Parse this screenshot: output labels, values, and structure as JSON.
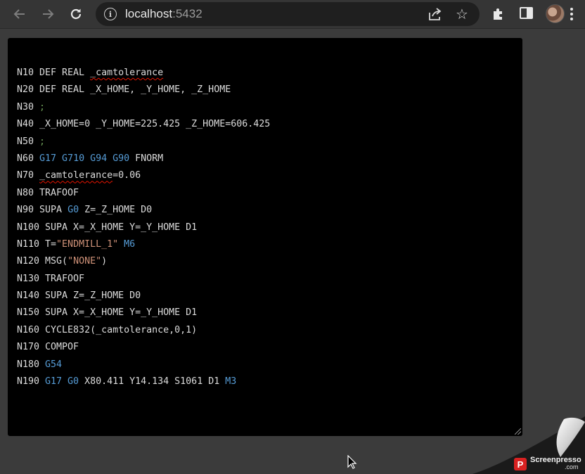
{
  "browser": {
    "url_host": "localhost",
    "url_port": ":5432",
    "icons": {
      "back": "back-arrow-icon",
      "forward": "forward-arrow-icon",
      "reload": "reload-icon",
      "info": "info-icon",
      "share": "share-icon",
      "bookmark": "star-icon",
      "extensions": "puzzle-icon",
      "side_panel": "side-panel-icon",
      "profile": "avatar",
      "menu": "kebab-menu-icon"
    }
  },
  "editor": {
    "colors": {
      "background": "#000000",
      "text": "#dcdcdc",
      "keyword": "#569cd6",
      "string": "#ce9178",
      "comment": "#6a9955",
      "squiggle": "#e51400"
    },
    "lines": [
      [
        {
          "t": "N10 DEF REAL "
        },
        {
          "t": "_camtolerance",
          "c": "sq"
        }
      ],
      [
        {
          "t": "N20 DEF REAL _X_HOME, _Y_HOME, _Z_HOME"
        }
      ],
      [
        {
          "t": "N30 "
        },
        {
          "t": ";",
          "c": "cmt"
        }
      ],
      [
        {
          "t": "N40 _X_HOME=0 _Y_HOME=225.425 _Z_HOME=606.425"
        }
      ],
      [
        {
          "t": "N50 "
        },
        {
          "t": ";",
          "c": "cmt"
        }
      ],
      [
        {
          "t": "N60 "
        },
        {
          "t": "G17 G710 G94 G90",
          "c": "kw"
        },
        {
          "t": " FNORM"
        }
      ],
      [
        {
          "t": "N70 "
        },
        {
          "t": "_camtolerance",
          "c": "sq"
        },
        {
          "t": "=0.06"
        }
      ],
      [
        {
          "t": "N80 TRAFOOF"
        }
      ],
      [
        {
          "t": "N90 SUPA "
        },
        {
          "t": "G0",
          "c": "kw"
        },
        {
          "t": " Z=_Z_HOME D0"
        }
      ],
      [
        {
          "t": "N100 SUPA X=_X_HOME Y=_Y_HOME D1"
        }
      ],
      [
        {
          "t": "N110 T="
        },
        {
          "t": "\"ENDMILL_1\"",
          "c": "str"
        },
        {
          "t": " "
        },
        {
          "t": "M6",
          "c": "kw"
        }
      ],
      [
        {
          "t": "N120 MSG("
        },
        {
          "t": "\"NONE\"",
          "c": "str"
        },
        {
          "t": ")"
        }
      ],
      [
        {
          "t": "N130 TRAFOOF"
        }
      ],
      [
        {
          "t": "N140 SUPA Z=_Z_HOME D0"
        }
      ],
      [
        {
          "t": "N150 SUPA X=_X_HOME Y=_Y_HOME D1"
        }
      ],
      [
        {
          "t": "N160 CYCLE832(_camtolerance,0,1)"
        }
      ],
      [
        {
          "t": "N170 COMPOF"
        }
      ],
      [
        {
          "t": "N180 "
        },
        {
          "t": "G54",
          "c": "kw"
        }
      ],
      [
        {
          "t": "N190 "
        },
        {
          "t": "G17 G0",
          "c": "kw"
        },
        {
          "t": " X80.411 Y14.134 S1061 D1 "
        },
        {
          "t": "M3",
          "c": "kw"
        }
      ]
    ]
  },
  "watermark": {
    "logo_letter": "P",
    "name": "Screenpresso",
    "suffix": ".com"
  }
}
